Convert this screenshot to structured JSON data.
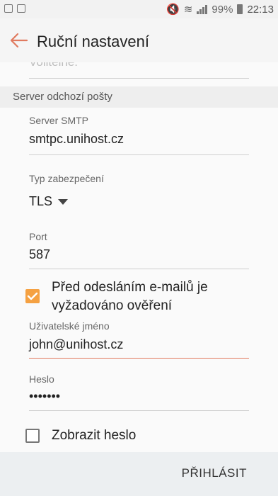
{
  "status_bar": {
    "battery": "99%",
    "time": "22:13"
  },
  "app_bar": {
    "title": "Ruční nastavení"
  },
  "content": {
    "prev_field_text": "Volitelné.",
    "section_header": "Server odchozí pošty",
    "smtp": {
      "label": "Server SMTP",
      "value": "smtpc.unihost.cz"
    },
    "security": {
      "label": "Typ zabezpečení",
      "value": "TLS"
    },
    "port": {
      "label": "Port",
      "value": "587"
    },
    "auth_required": {
      "label": "Před odesláním e-mailů je vyžadováno ověření",
      "checked": true
    },
    "username": {
      "label": "Uživatelské jméno",
      "value": "john@unihost.cz"
    },
    "password": {
      "label": "Heslo",
      "value": "•••••••"
    },
    "show_password": {
      "label": "Zobrazit heslo",
      "checked": false
    }
  },
  "bottom_bar": {
    "login_label": "PŘIHLÁSIT"
  },
  "colors": {
    "accent": "#e07a5f",
    "checkbox_checked": "#f5a142"
  }
}
